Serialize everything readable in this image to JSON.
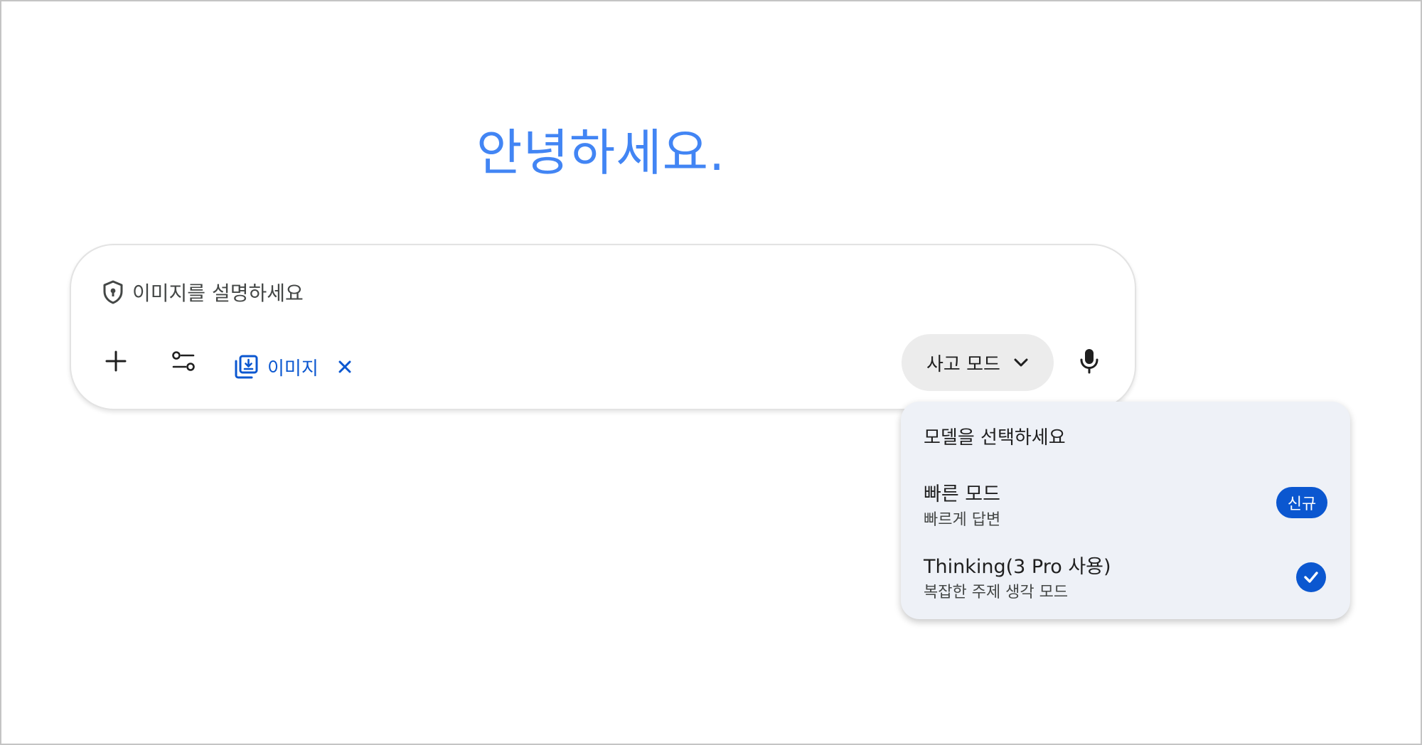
{
  "greeting": "안녕하세요.",
  "composer": {
    "placeholder": "이미지를 설명하세요",
    "shield_icon": "shield-lock-icon",
    "add_icon": "plus-icon",
    "tools_icon": "tune-icon",
    "chip": {
      "label": "이미지",
      "icon": "image-gallery-icon",
      "close_icon": "close-icon"
    },
    "mode_button": {
      "label": "사고 모드",
      "icon": "chevron-down-icon"
    },
    "mic_icon": "microphone-icon"
  },
  "model_menu": {
    "title": "모델을 선택하세요",
    "options": [
      {
        "label": "빠른 모드",
        "description": "빠르게 답변",
        "badge": "신규",
        "selected": false
      },
      {
        "label": "Thinking(3 Pro 사용)",
        "description": "복잡한 주제 생각 모드",
        "selected": true
      }
    ]
  },
  "colors": {
    "greeting": "#4285f4",
    "accent": "#0b57d0",
    "menu_bg": "#eef1f7",
    "mode_button_bg": "#ececec"
  }
}
